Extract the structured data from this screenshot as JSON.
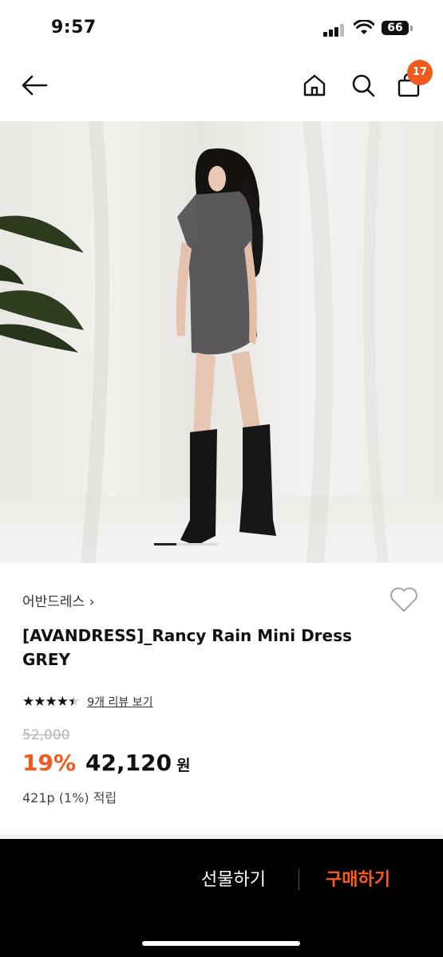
{
  "status_bar": {
    "time": "9:57",
    "battery": "66"
  },
  "nav": {
    "cart_count": "17",
    "icons": [
      "back-arrow-icon",
      "home-icon",
      "search-icon",
      "shopping-bag-icon"
    ]
  },
  "product": {
    "brand": "어반드레스 ›",
    "title": "[AVANDRESS]_Rancy Rain Mini Dress GREY",
    "rating": 4.5,
    "stars": "★★★★★",
    "review_link": "9개 리뷰 보기",
    "original_price": "52,000",
    "discount": "19%",
    "price": "42,120",
    "currency": "원",
    "points": "421p (1%) 적립",
    "image_page_progress": 0.35
  },
  "bottom_bar": {
    "gift_label": "선물하기",
    "buy_label": "구매하기",
    "icons": [
      "heart-icon",
      "share-icon"
    ]
  },
  "colors": {
    "accent": "#ef5a1f",
    "buy": "#ff5a1f",
    "bottom_bg": "#000000"
  }
}
